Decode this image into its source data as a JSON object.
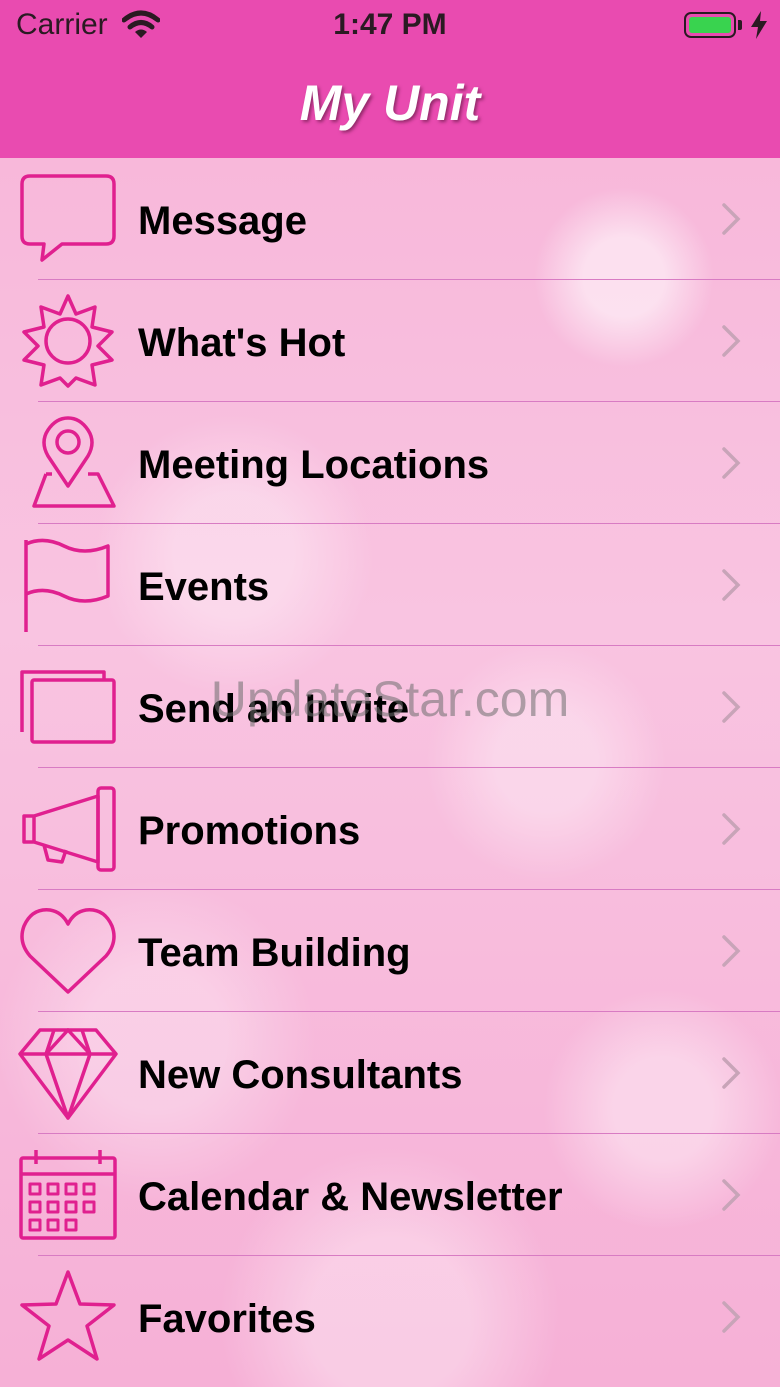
{
  "status_bar": {
    "carrier": "Carrier",
    "time": "1:47 PM",
    "wifi_icon": "wifi-icon",
    "battery_icon": "battery-icon",
    "charging_icon": "charging-bolt-icon",
    "battery_color": "#39d34f"
  },
  "nav": {
    "title": "My Unit",
    "bar_color": "#e94bb0"
  },
  "menu": {
    "accent_color": "#e0208f",
    "items": [
      {
        "label": "Message",
        "icon": "speech-bubble-icon"
      },
      {
        "label": "What's Hot",
        "icon": "sun-icon"
      },
      {
        "label": "Meeting Locations",
        "icon": "map-pin-icon"
      },
      {
        "label": "Events",
        "icon": "flag-icon"
      },
      {
        "label": "Send an Invite",
        "icon": "cards-icon"
      },
      {
        "label": "Promotions",
        "icon": "megaphone-icon"
      },
      {
        "label": "Team Building",
        "icon": "heart-icon"
      },
      {
        "label": "New Consultants",
        "icon": "diamond-icon"
      },
      {
        "label": "Calendar & Newsletter",
        "icon": "calendar-icon"
      },
      {
        "label": "Favorites",
        "icon": "star-icon"
      }
    ]
  },
  "watermark": "UpdateStar.com"
}
